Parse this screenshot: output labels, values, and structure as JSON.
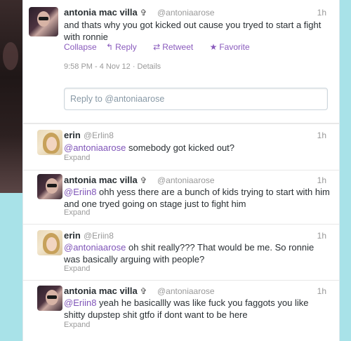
{
  "main_tweet": {
    "name": "antonia mac villa",
    "verified_glyph": "✞",
    "handle": "@antoniaarose",
    "time": "1h",
    "text": "and thats why you got kicked out cause you tryed to start a fight with ronnie",
    "actions": {
      "collapse": "Collapse",
      "reply": "Reply",
      "retweet": "Retweet",
      "favorite": "Favorite"
    },
    "meta": "9:58 PM - 4 Nov 12 · Details",
    "reply_placeholder": "Reply to @antoniaarose"
  },
  "replies": [
    {
      "name": "erin",
      "verified_glyph": "",
      "handle": "@Erlin8",
      "time": "1h",
      "mention": "@antoniaarose",
      "text": " somebody got kicked out?",
      "expand": "Expand"
    },
    {
      "name": "antonia mac villa",
      "verified_glyph": "✞",
      "handle": "@antoniaarose",
      "time": "1h",
      "mention": "@Eriin8",
      "text": " ohh yess there are a bunch of kids trying to start with him and one tryed going on stage just to fight him",
      "expand": "Expand"
    },
    {
      "name": "erin",
      "verified_glyph": "",
      "handle": "@Eriin8",
      "time": "1h",
      "mention": "@antoniaarose",
      "text": " oh shit really??? That would be me. So ronnie was basically arguing with people?",
      "expand": "Expand"
    },
    {
      "name": "antonia mac villa",
      "verified_glyph": "✞",
      "handle": "@antoniaarose",
      "time": "1h",
      "mention": "@Eriin8",
      "text": " yeah he basicallly was like fuck you faggots you like shitty dupstep shit gtfo if dont want to be here",
      "expand": "Expand"
    }
  ],
  "colors": {
    "link": "#7f54b8",
    "background": "#a8e2e8"
  },
  "icons": {
    "reply": "reply-icon",
    "retweet": "retweet-icon",
    "favorite": "star-icon"
  }
}
